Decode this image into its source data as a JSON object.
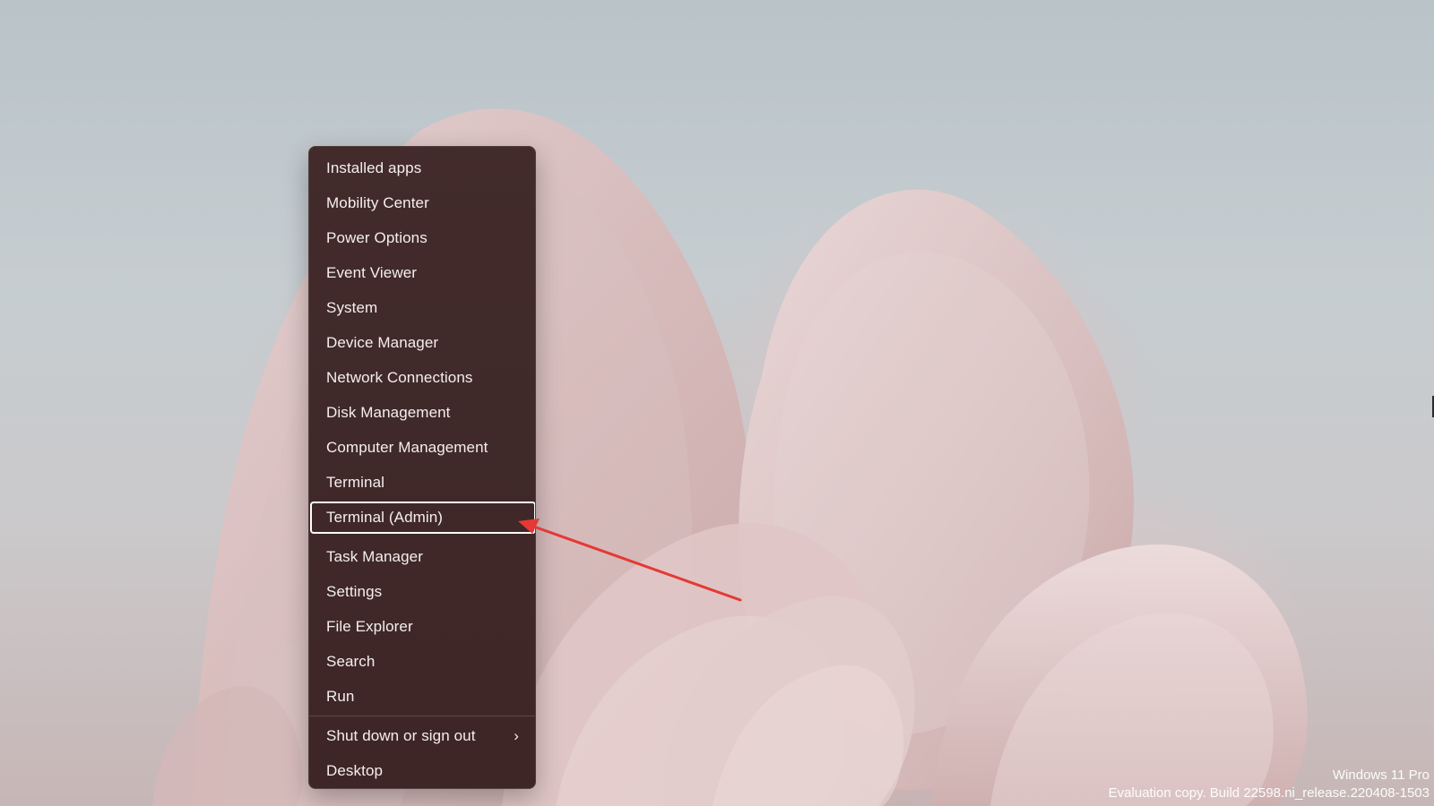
{
  "context_menu": {
    "items": [
      {
        "label": "Installed apps"
      },
      {
        "label": "Mobility Center"
      },
      {
        "label": "Power Options"
      },
      {
        "label": "Event Viewer"
      },
      {
        "label": "System"
      },
      {
        "label": "Device Manager"
      },
      {
        "label": "Network Connections"
      },
      {
        "label": "Disk Management"
      },
      {
        "label": "Computer Management"
      },
      {
        "label": "Terminal"
      },
      {
        "label": "Terminal (Admin)",
        "selected": true
      },
      {
        "label": "Task Manager"
      },
      {
        "label": "Settings"
      },
      {
        "label": "File Explorer"
      },
      {
        "label": "Search"
      },
      {
        "label": "Run"
      },
      {
        "label": "Shut down or sign out",
        "submenu": true
      },
      {
        "label": "Desktop"
      }
    ],
    "submenu_icon": "chevron-right-icon",
    "submenu_chevron": "›"
  },
  "watermark": {
    "line1": "Windows 11 Pro",
    "line2": "Evaluation copy. Build 22598.ni_release.220408-1503"
  },
  "colors": {
    "menu_background": "#402929",
    "menu_text": "#f5eeee",
    "selection_outline": "#ffffff",
    "annotation_arrow": "#e53935"
  }
}
